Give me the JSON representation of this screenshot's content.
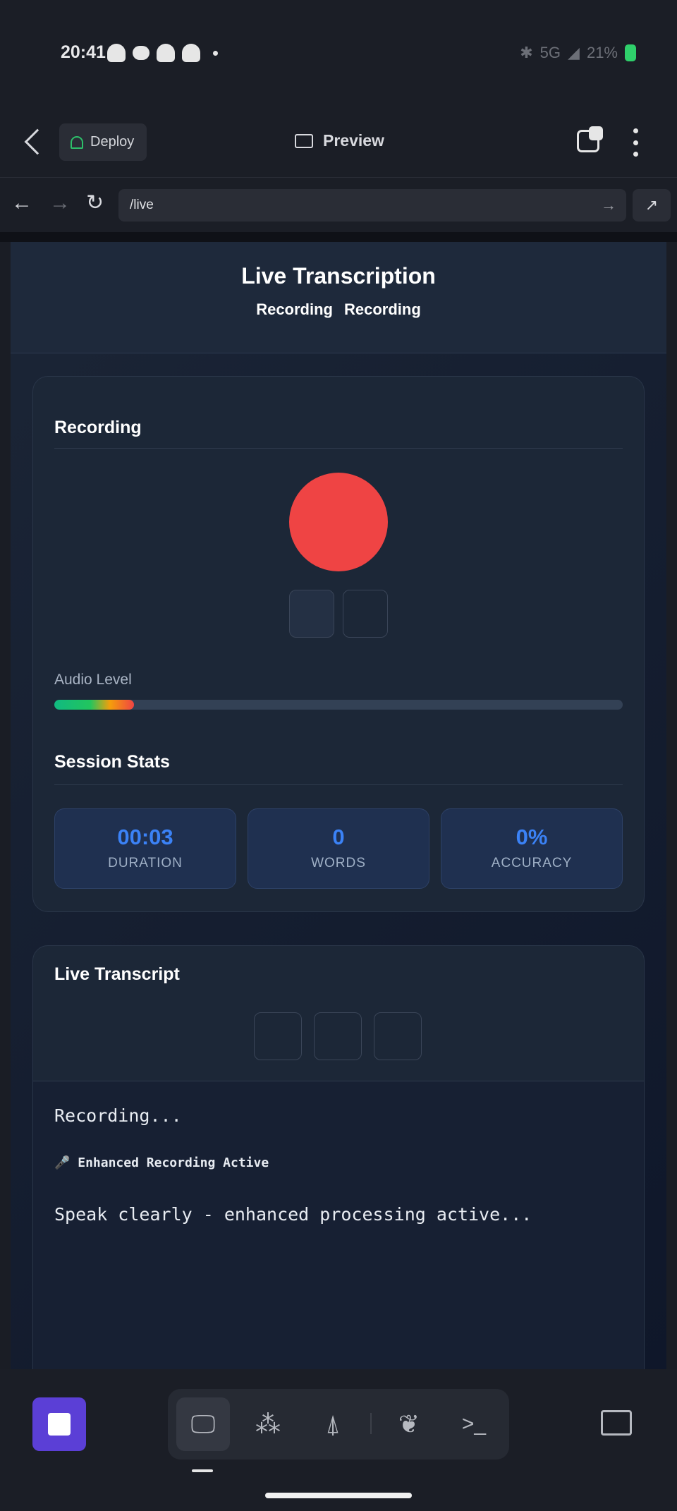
{
  "status_bar": {
    "time": "20:41",
    "network": "5G",
    "battery": "21%"
  },
  "toolbar": {
    "deploy_label": "Deploy",
    "preview_label": "Preview"
  },
  "url_bar": {
    "url": "/live"
  },
  "page": {
    "title": "Live Transcription",
    "header_tags": [
      "Recording",
      "Recording"
    ],
    "recording_card": {
      "title": "Recording",
      "audio_level_label": "Audio Level",
      "audio_level_value": 0.14,
      "stats_title": "Session Stats",
      "stats": [
        {
          "value": "00:03",
          "label": "DURATION"
        },
        {
          "value": "0",
          "label": "WORDS"
        },
        {
          "value": "0%",
          "label": "ACCURACY"
        }
      ]
    },
    "transcript_card": {
      "title": "Live Transcript",
      "status_line": "Recording...",
      "enhanced_line": "🎤 Enhanced Recording Active",
      "hint_line": "Speak clearly - enhanced processing active..."
    }
  },
  "colors": {
    "record": "#ef4444",
    "accent": "#3b82f6",
    "stop_button": "#5b3fd6",
    "deploy_icon": "#2dbf6a"
  },
  "icons": [
    "back-icon",
    "deploy-icon",
    "monitor-icon",
    "tabs-icon",
    "more-icon",
    "forward-icon",
    "reload-icon",
    "go-icon",
    "external-link-icon",
    "stop-icon",
    "preview-icon",
    "gallery-icon",
    "deploy-dock-icon",
    "shell-icon",
    "terminal-icon",
    "panel-icon"
  ]
}
